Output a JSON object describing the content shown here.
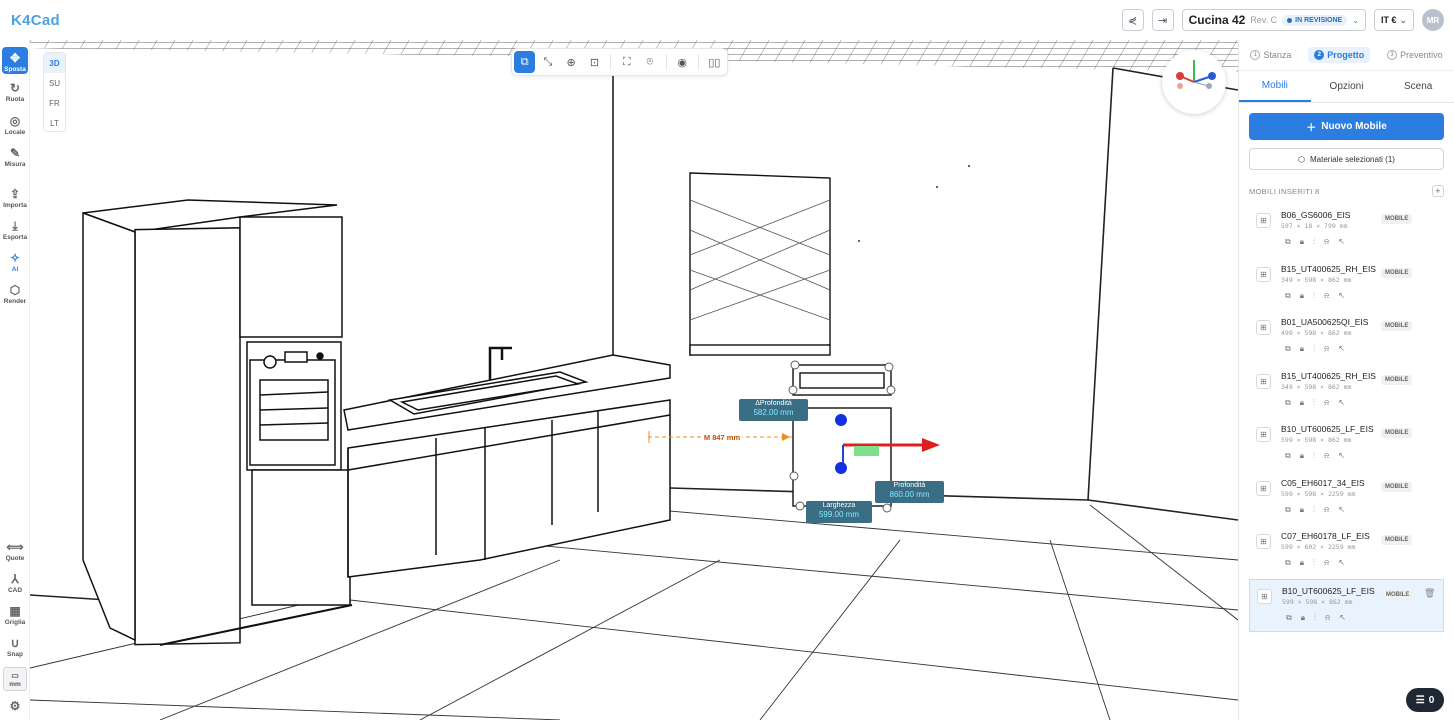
{
  "app": {
    "logo": "K4Cad"
  },
  "header": {
    "project_name": "Cucina 42",
    "revision": "Rev. C",
    "status": "IN REVISIONE",
    "language": "IT €",
    "user_initials": "MR"
  },
  "leftbar": {
    "items": [
      {
        "label": "Sposta",
        "icon": "move-icon"
      },
      {
        "label": "Ruota",
        "icon": "rotate-icon"
      },
      {
        "label": "Locale",
        "icon": "globe-icon"
      },
      {
        "label": "Misura",
        "icon": "ruler-icon"
      },
      {
        "label": "Importa",
        "icon": "upload-icon"
      },
      {
        "label": "Esporta",
        "icon": "download-icon"
      },
      {
        "label": "AI",
        "icon": "sparkle-icon"
      },
      {
        "label": "Render",
        "icon": "cube-icon"
      },
      {
        "label": "Quote",
        "icon": "dimension-icon"
      },
      {
        "label": "CAD",
        "icon": "compass-icon"
      },
      {
        "label": "Griglia",
        "icon": "grid-icon"
      },
      {
        "label": "Snap",
        "icon": "magnet-icon"
      },
      {
        "label": "mm",
        "icon": "units-icon"
      }
    ]
  },
  "view_modes": [
    "3D",
    "SU",
    "FR",
    "LT"
  ],
  "viewport": {
    "dim_depth_title": "ΔProfondità",
    "dim_depth_value": "582.00 mm",
    "dim_distance": "M 847 mm",
    "dim_height_title": "Profondità",
    "dim_height_value": "860.00 mm",
    "dim_width_title": "Larghezza",
    "dim_width_value": "599.00 mm"
  },
  "panel": {
    "steps": [
      {
        "num": "1",
        "label": "Stanza"
      },
      {
        "num": "2",
        "label": "Progetto"
      },
      {
        "num": "3",
        "label": "Preventivo"
      }
    ],
    "tabs": [
      "Mobili",
      "Opzioni",
      "Scena"
    ],
    "new_button": "Nuovo Mobile",
    "material_button": "Materiale selezionati (1)",
    "section_title": "MOBILI INSERITI",
    "section_count": "8",
    "items": [
      {
        "name": "B06_GS6006_EIS",
        "dims": "597 × 18 × 799 mm",
        "tag": "MOBILE"
      },
      {
        "name": "B15_UT400625_RH_EIS",
        "dims": "349 × 598 × 862 mm",
        "tag": "MOBILE"
      },
      {
        "name": "B01_UA500625QI_EIS",
        "dims": "499 × 598 × 862 mm",
        "tag": "MOBILE"
      },
      {
        "name": "B15_UT400625_RH_EIS",
        "dims": "349 × 598 × 862 mm",
        "tag": "MOBILE"
      },
      {
        "name": "B10_UT600625_LF_EIS",
        "dims": "599 × 598 × 862 mm",
        "tag": "MOBILE"
      },
      {
        "name": "C05_EH6017_34_EIS",
        "dims": "599 × 598 × 2259 mm",
        "tag": "MOBILE"
      },
      {
        "name": "C07_EH60178_LF_EIS",
        "dims": "599 × 602 × 2259 mm",
        "tag": "MOBILE"
      },
      {
        "name": "B10_UT600625_LF_EIS",
        "dims": "599 × 598 × 862 mm",
        "tag": "MOBILE"
      }
    ]
  },
  "fab": {
    "count": "0"
  },
  "colors": {
    "accent": "#2b7de0",
    "label_bg": "#3b6d84",
    "label_value": "#7ee9ff"
  }
}
